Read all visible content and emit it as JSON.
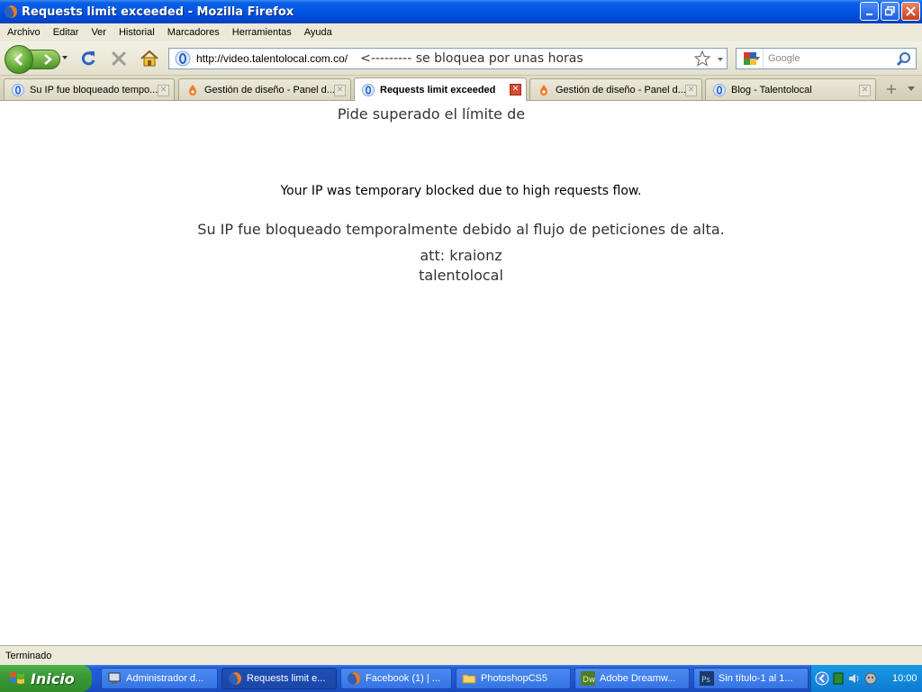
{
  "window": {
    "title": "Requests limit exceeded - Mozilla Firefox"
  },
  "menu": [
    "Archivo",
    "Editar",
    "Ver",
    "Historial",
    "Marcadores",
    "Herramientas",
    "Ayuda"
  ],
  "navigation": {
    "url": "http://video.talentolocal.com.co/",
    "url_note": "<--------- se bloquea por unas horas",
    "search_placeholder": "Google"
  },
  "tabs": [
    {
      "label": "Su IP fue bloqueado tempo...",
      "icon": "bluebubble-icon",
      "active": false
    },
    {
      "label": "Gestión de diseño - Panel d...",
      "icon": "orangedrop-icon",
      "active": false
    },
    {
      "label": "Requests limit exceeded",
      "icon": "bluebubble-icon",
      "active": true
    },
    {
      "label": "Gestión de diseño - Panel d...",
      "icon": "orangedrop-icon",
      "active": false
    },
    {
      "label": "Blog - Talentolocal",
      "icon": "bluebubble-icon",
      "active": false
    }
  ],
  "page": {
    "line1": "Pide superado el límite de",
    "line2": "Your IP was temporary blocked due to high requests flow.",
    "line3": "Su IP fue bloqueado temporalmente debido al flujo de peticiones de alta.",
    "line4": "att: kraionz",
    "line5": "talentolocal"
  },
  "status": {
    "text": "Terminado"
  },
  "taskbar": {
    "start_label": "Inicio",
    "items": [
      {
        "label": "Administrador d...",
        "icon": "computer-icon",
        "active": false
      },
      {
        "label": "Requests limit e...",
        "icon": "firefox-icon",
        "active": true
      },
      {
        "label": "Facebook (1) | ...",
        "icon": "firefox-icon",
        "active": false
      },
      {
        "label": "PhotoshopCS5",
        "icon": "folder-icon",
        "active": false
      },
      {
        "label": "Adobe Dreamw...",
        "icon": "dreamweaver-icon",
        "active": false
      },
      {
        "label": "Sin título-1 al 1...",
        "icon": "photoshop-icon",
        "active": false
      }
    ],
    "clock": "10:00"
  },
  "colors": {
    "titlebar": "#0155e3",
    "taskbar": "#245edc",
    "start": "#3a9a36",
    "tray": "#1899e6"
  }
}
